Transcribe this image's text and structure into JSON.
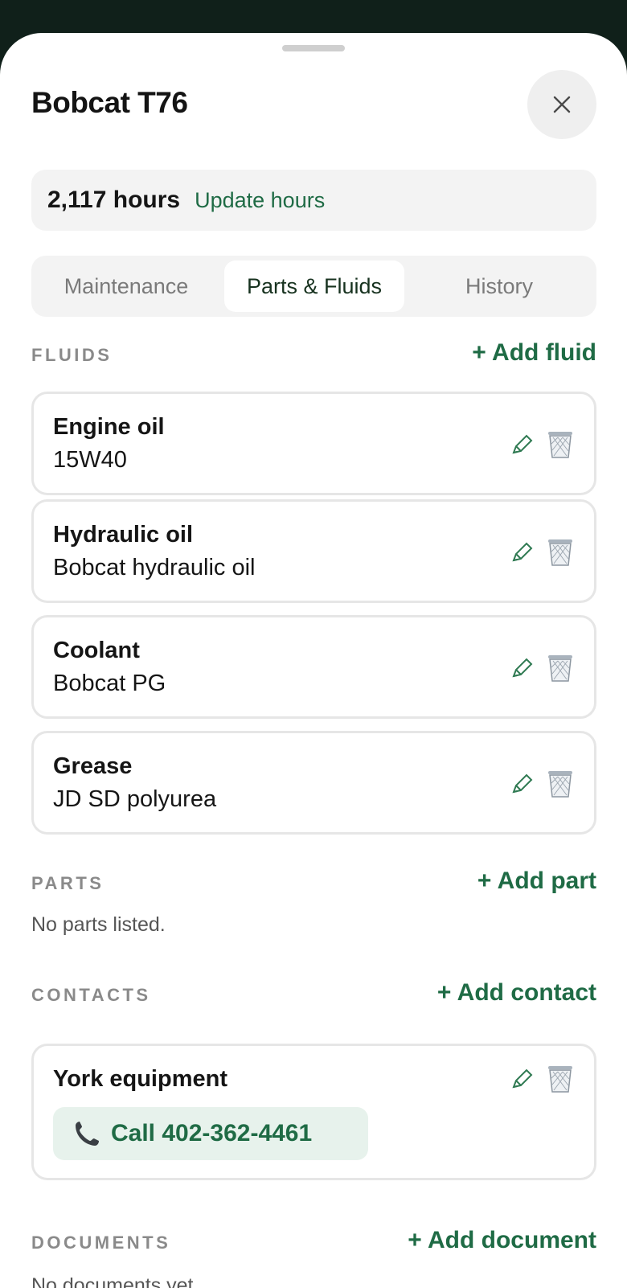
{
  "sheet": {
    "title": "Bobcat T76",
    "hours_value": "2,117 hours",
    "hours_link": "Update hours"
  },
  "tabs": [
    {
      "label": "Maintenance",
      "selected": false
    },
    {
      "label": "Parts & Fluids",
      "selected": true
    },
    {
      "label": "History",
      "selected": false
    }
  ],
  "fluids": {
    "label": "FLUIDS",
    "add_label": "+ Add fluid",
    "items": [
      {
        "name": "Engine oil",
        "value": "15W40"
      },
      {
        "name": "Hydraulic oil",
        "value": "Bobcat hydraulic oil"
      },
      {
        "name": "Coolant",
        "value": "Bobcat PG"
      },
      {
        "name": "Grease",
        "value": "JD SD polyurea"
      }
    ]
  },
  "parts": {
    "label": "PARTS",
    "add_label": "+ Add part",
    "empty_text": "No parts listed."
  },
  "contacts": {
    "label": "CONTACTS",
    "add_label": "+ Add contact",
    "items": [
      {
        "name": "York equipment",
        "call_label": "Call 402-362-4461"
      }
    ]
  },
  "documents": {
    "label": "DOCUMENTS",
    "add_label": "+ Add document",
    "empty_text": "No documents yet."
  },
  "icons": {
    "close": "close-icon",
    "edit": "pencil-icon",
    "delete": "trash-icon",
    "phone": "phone-icon"
  },
  "colors": {
    "accent": "#1f6b45",
    "accent_bg": "#e7f2ec",
    "backdrop": "#10201a"
  }
}
